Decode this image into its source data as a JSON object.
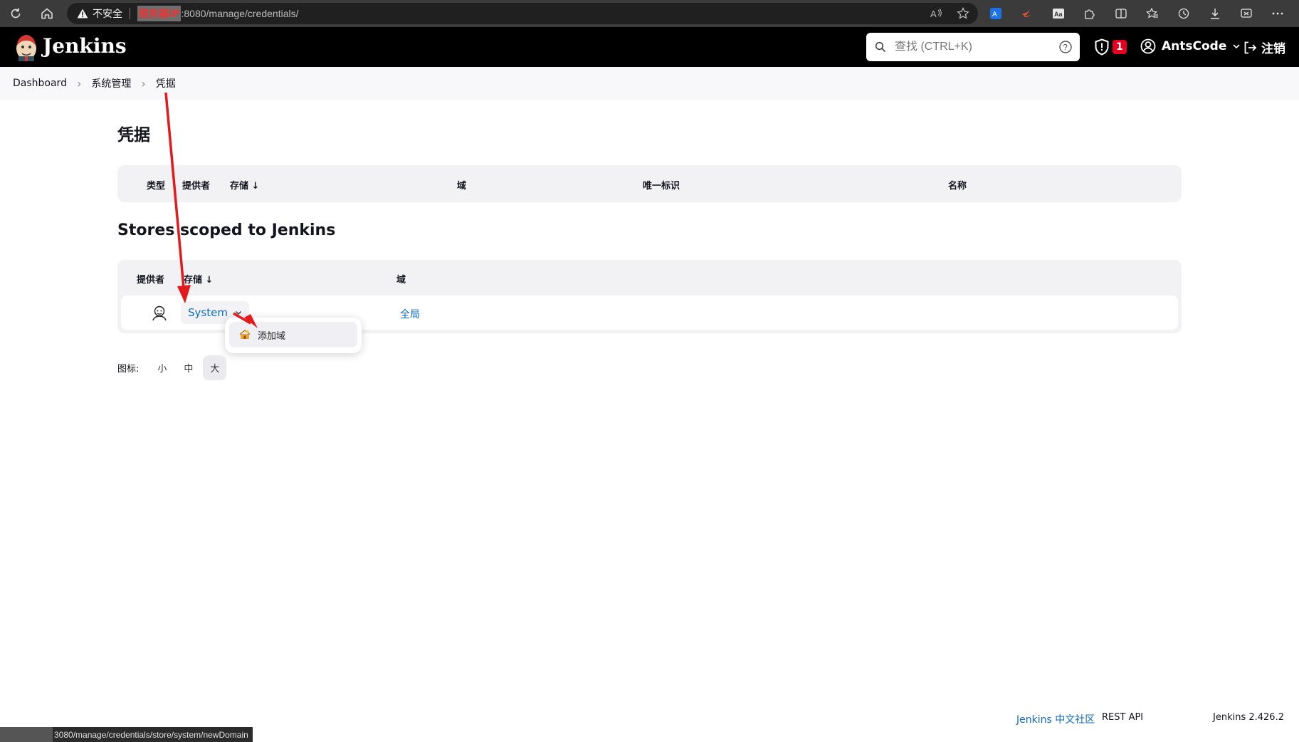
{
  "browser": {
    "insecure_label": "不安全",
    "ip_mask_label": "服务器IP",
    "url": ":8080/manage/credentials/"
  },
  "header": {
    "title": "Jenkins",
    "search_placeholder": "查找 (CTRL+K)",
    "security_badge": "1",
    "user_name": "AntsCode",
    "logout_label": "注销"
  },
  "breadcrumb": {
    "items": [
      "Dashboard",
      "系统管理",
      "凭据"
    ]
  },
  "credentials": {
    "title": "凭据",
    "columns": [
      "类型",
      "提供者",
      "存储 ↓",
      "域",
      "唯一标识",
      "名称"
    ]
  },
  "stores": {
    "title": "Stores scoped to Jenkins",
    "columns": [
      "提供者",
      "存储 ↓",
      "域"
    ],
    "rows": [
      {
        "store": "System",
        "domain": "全局"
      }
    ]
  },
  "dropdown": {
    "items": [
      "添加域"
    ]
  },
  "icon_size": {
    "label": "图标:",
    "options": [
      "小",
      "中",
      "大"
    ],
    "selected": "大"
  },
  "footer": {
    "community": "Jenkins 中文社区",
    "rest_api": "REST API",
    "version": "Jenkins 2.426.2"
  },
  "statusbar": {
    "url": "3080/manage/credentials/store/system/newDomain"
  },
  "colors": {
    "link": "#0b6aca",
    "arrow": "#e3191c",
    "badge": "#e6001f"
  }
}
